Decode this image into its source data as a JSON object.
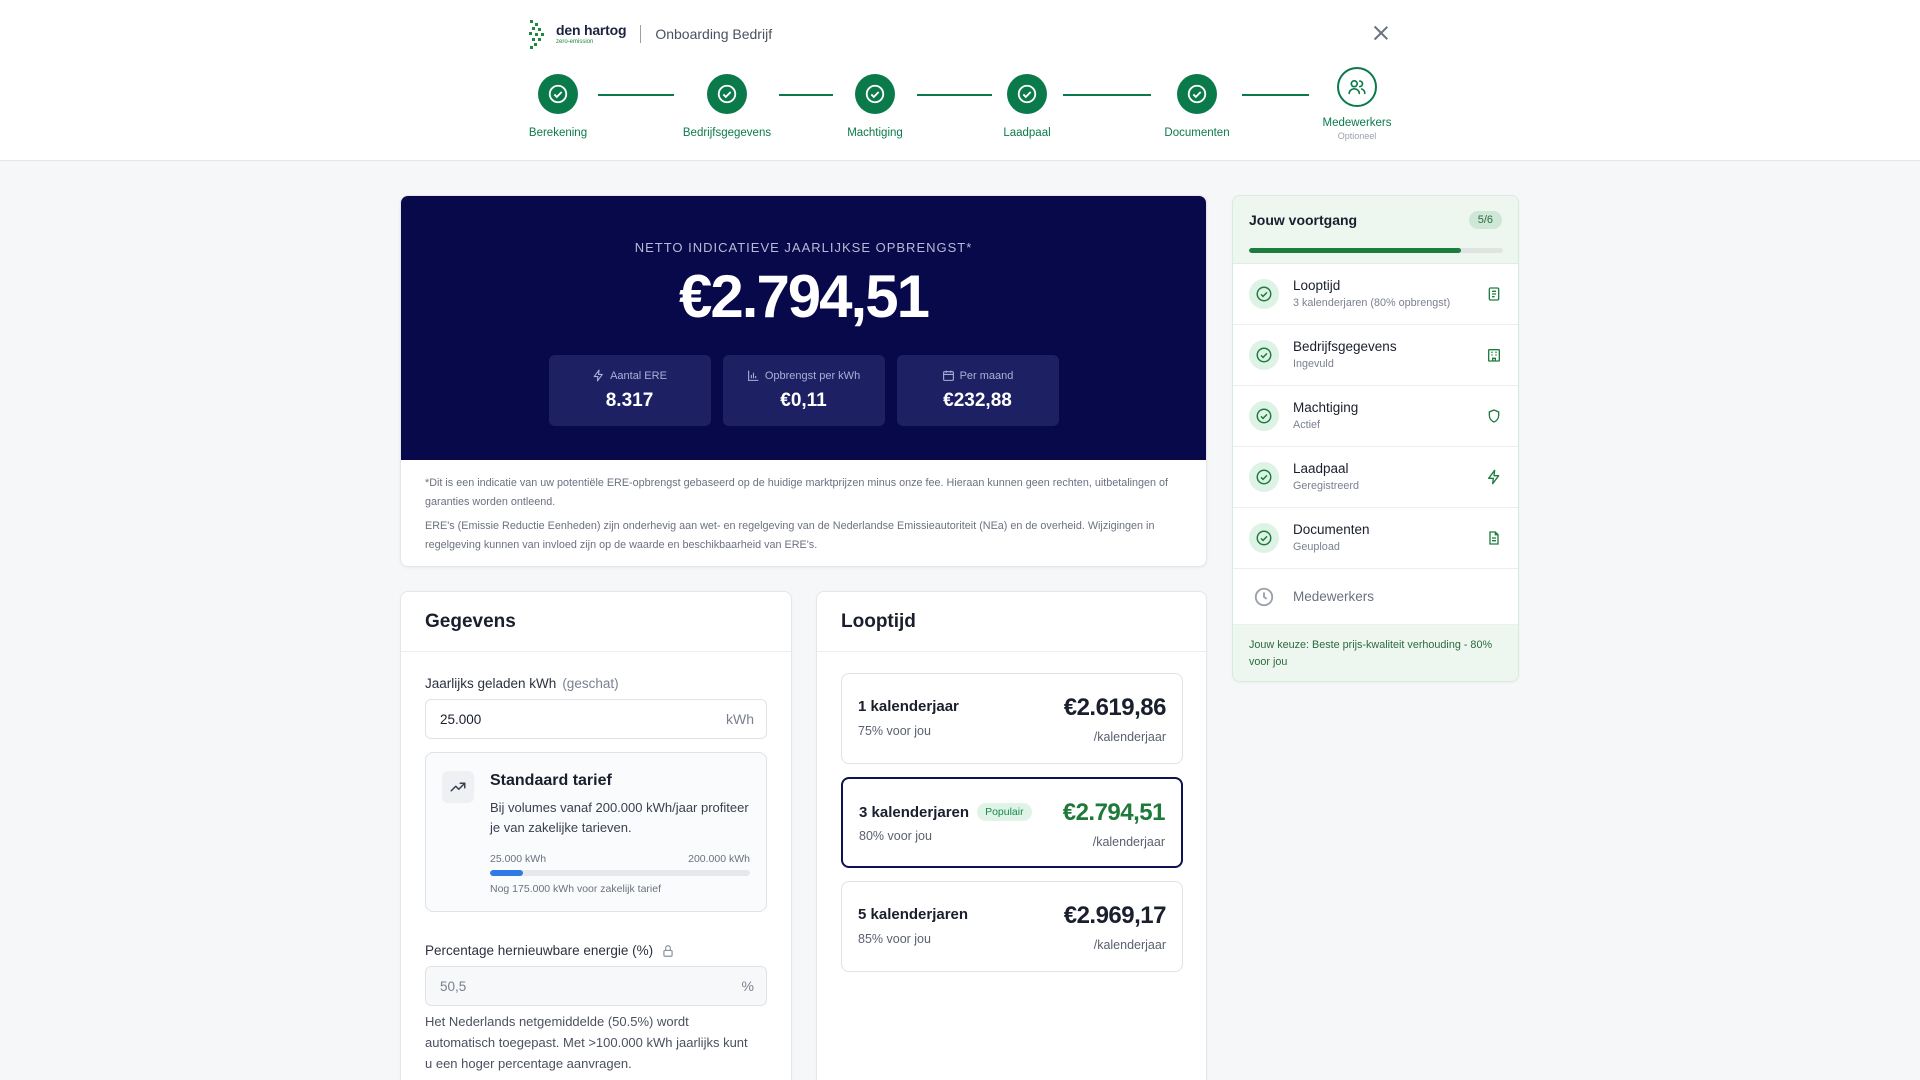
{
  "header": {
    "brand_name": "den hartog",
    "brand_tagline": "zero-emission",
    "title": "Onboarding Bedrijf"
  },
  "steps": [
    {
      "label": "Berekening",
      "status": "done"
    },
    {
      "label": "Bedrijfsgegevens",
      "status": "done"
    },
    {
      "label": "Machtiging",
      "status": "done"
    },
    {
      "label": "Laadpaal",
      "status": "done"
    },
    {
      "label": "Documenten",
      "status": "done"
    },
    {
      "label": "Medewerkers",
      "sub": "Optioneel",
      "status": "optional"
    }
  ],
  "hero": {
    "caption": "NETTO INDICATIEVE JAARLIJKSE OPBRENGST*",
    "amount": "€2.794,51",
    "stats": [
      {
        "label": "Aantal ERE",
        "value": "8.317",
        "icon": "lightning-icon"
      },
      {
        "label": "Opbrengst per kWh",
        "value": "€0,11",
        "icon": "bar-chart-icon"
      },
      {
        "label": "Per maand",
        "value": "€232,88",
        "icon": "calendar-icon"
      }
    ],
    "note1": "*Dit is een indicatie van uw potentiële ERE-opbrengst gebaseerd op de huidige marktprijzen minus onze fee. Hieraan kunnen geen rechten, uitbetalingen of garanties worden ontleend.",
    "note2": "ERE's (Emissie Reductie Eenheden) zijn onderhevig aan wet- en regelgeving van de Nederlandse Emissieautoriteit (NEa) en de overheid. Wijzigingen in regelgeving kunnen van invloed zijn op de waarde en beschikbaarheid van ERE's."
  },
  "gegevens": {
    "title": "Gegevens",
    "kwh_label": "Jaarlijks geladen kWh",
    "kwh_label_muted": "(geschat)",
    "kwh_value": "25.000",
    "kwh_unit": "kWh",
    "tarief_title": "Standaard tarief",
    "tarief_desc": "Bij volumes vanaf 200.000 kWh/jaar profiteer je van zakelijke tarieven.",
    "range_min": "25.000 kWh",
    "range_max": "200.000 kWh",
    "range_progress": 0.125,
    "range_note": "Nog 175.000 kWh voor zakelijk tarief",
    "pct_label": "Percentage hernieuwbare energie (%)",
    "pct_value": "50,5",
    "pct_unit": "%",
    "pct_help": "Het Nederlands netgemiddelde (50.5%) wordt automatisch toegepast. Met >100.000 kWh jaarlijks kunt u een hoger percentage aanvragen."
  },
  "looptijd": {
    "title": "Looptijd",
    "options": [
      {
        "title": "1 kalenderjaar",
        "sub": "75% voor jou",
        "price": "€2.619,86",
        "unit": "/kalenderjaar",
        "badge": ""
      },
      {
        "title": "3 kalenderjaren",
        "sub": "80% voor jou",
        "price": "€2.794,51",
        "unit": "/kalenderjaar",
        "badge": "Populair"
      },
      {
        "title": "5 kalenderjaren",
        "sub": "85% voor jou",
        "price": "€2.969,17",
        "unit": "/kalenderjaar",
        "badge": ""
      }
    ]
  },
  "progress": {
    "title": "Jouw voortgang",
    "count": "5/6",
    "fraction": 0.833,
    "items": [
      {
        "title": "Looptijd",
        "sub": "3 kalenderjaren (80% opbrengst)",
        "icon": "clipboard-icon"
      },
      {
        "title": "Bedrijfsgegevens",
        "sub": "Ingevuld",
        "icon": "building-icon"
      },
      {
        "title": "Machtiging",
        "sub": "Actief",
        "icon": "shield-icon"
      },
      {
        "title": "Laadpaal",
        "sub": "Geregistreerd",
        "icon": "lightning-icon"
      },
      {
        "title": "Documenten",
        "sub": "Geupload",
        "icon": "document-icon"
      }
    ],
    "pending": "Medewerkers",
    "footer": "Jouw keuze: Beste prijs-kwaliteit verhouding - 80% voor jou"
  },
  "colors": {
    "brand_green": "#0b7a4b",
    "hero_navy": "#08094a",
    "accent_blue": "#2f7ae5"
  }
}
